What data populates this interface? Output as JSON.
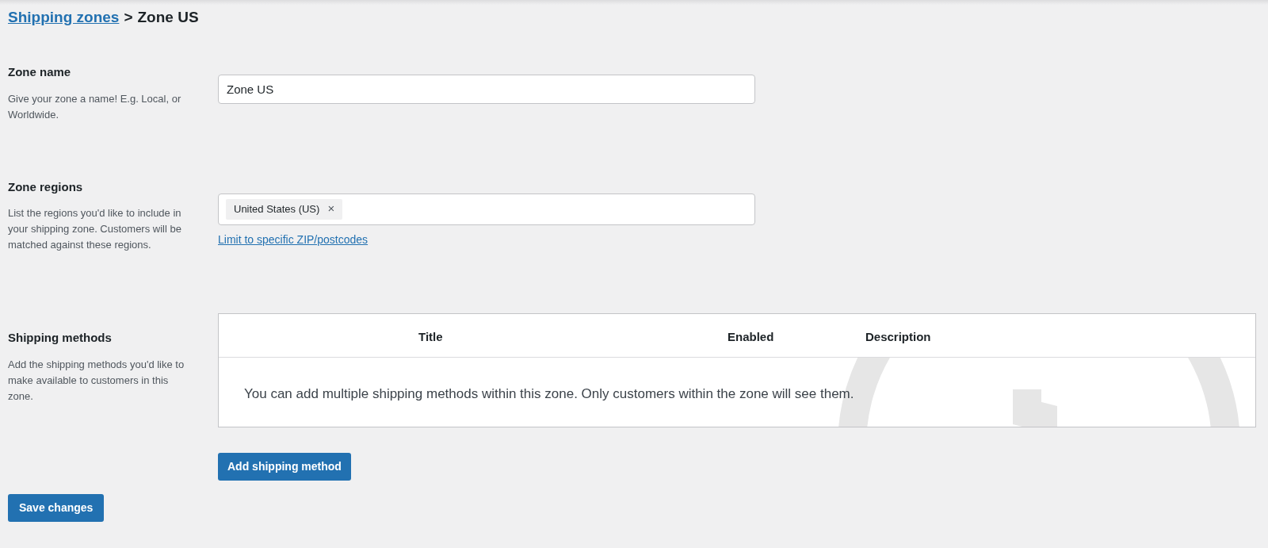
{
  "breadcrumb": {
    "link": "Shipping zones",
    "separator": ">",
    "current": "Zone US"
  },
  "zone_name": {
    "label": "Zone name",
    "description": "Give your zone a name! E.g. Local, or Worldwide.",
    "value": "Zone US"
  },
  "zone_regions": {
    "label": "Zone regions",
    "description": "List the regions you'd like to include in your shipping zone. Customers will be matched against these regions.",
    "tags": [
      {
        "label": "United States (US)",
        "remove": "×"
      }
    ],
    "link": "Limit to specific ZIP/postcodes"
  },
  "shipping_methods": {
    "label": "Shipping methods",
    "description": "Add the shipping methods you'd like to make available to customers in this zone.",
    "columns": [
      "Title",
      "Enabled",
      "Description"
    ],
    "empty_message": "You can add multiple shipping methods within this zone. Only customers within the zone will see them.",
    "button": "Add shipping method"
  },
  "save_button": "Save changes"
}
